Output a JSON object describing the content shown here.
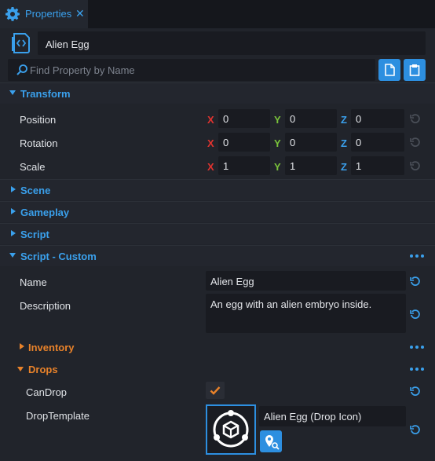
{
  "tab": {
    "title": "Properties",
    "close": "✕"
  },
  "object": {
    "name": "Alien Egg"
  },
  "search": {
    "placeholder": "Find Property by Name"
  },
  "sections": {
    "transform": "Transform",
    "scene": "Scene",
    "gameplay": "Gameplay",
    "script": "Script",
    "script_custom": "Script - Custom"
  },
  "transform": {
    "axis_labels": [
      "X",
      "Y",
      "Z"
    ],
    "position": {
      "label": "Position",
      "x": "0",
      "y": "0",
      "z": "0"
    },
    "rotation": {
      "label": "Rotation",
      "x": "0",
      "y": "0",
      "z": "0"
    },
    "scale": {
      "label": "Scale",
      "x": "1",
      "y": "1",
      "z": "1"
    }
  },
  "custom": {
    "name_label": "Name",
    "name_value": "Alien Egg",
    "description_label": "Description",
    "description_value": "An egg with an alien embryo inside.",
    "inventory": "Inventory",
    "drops": "Drops",
    "candrop_label": "CanDrop",
    "candrop_checked": true,
    "droptemplate_label": "DropTemplate",
    "droptemplate_value": "Alien Egg (Drop Icon)"
  },
  "colors": {
    "accent": "#3aa0ec",
    "subsection": "#e8822a",
    "axis_x": "#e0332f",
    "axis_y": "#7bc53b",
    "axis_z": "#3aa0ec"
  }
}
